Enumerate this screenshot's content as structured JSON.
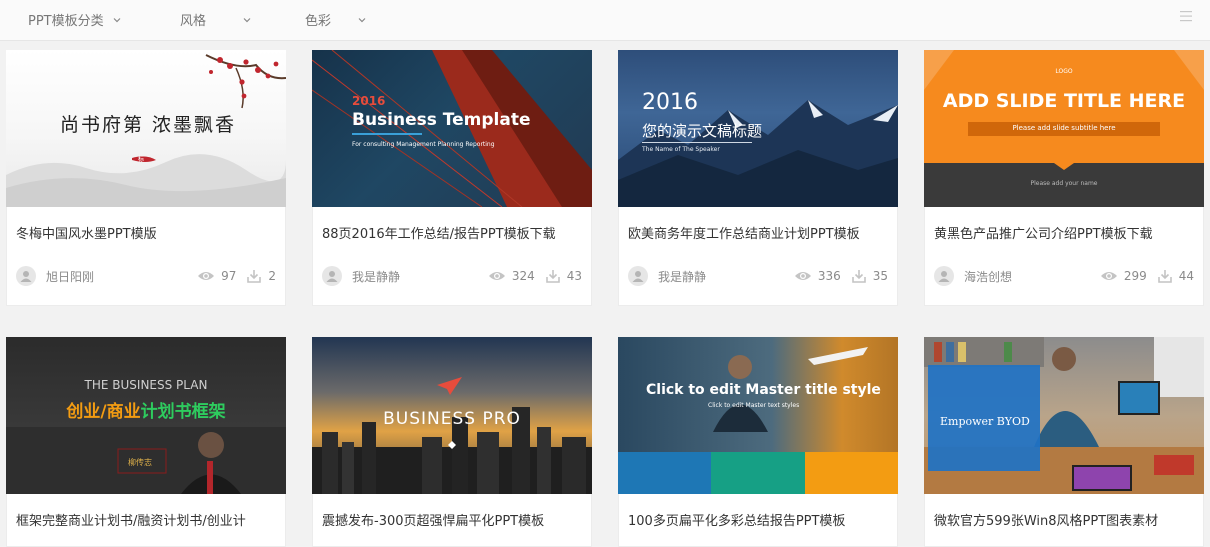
{
  "filters": [
    {
      "label": "PPT模板分类"
    },
    {
      "label": "风格"
    },
    {
      "label": "色彩"
    }
  ],
  "cards": [
    {
      "title": "冬梅中国风水墨PPT模版",
      "author": "旭日阳刚",
      "views": "97",
      "downloads": "2",
      "thumb": {
        "main": "尚书府第  浓墨飘香",
        "stamp": "标"
      }
    },
    {
      "title": "88页2016年工作总结/报告PPT模板下载",
      "author": "我是静静",
      "views": "324",
      "downloads": "43",
      "thumb": {
        "year": "2016",
        "main": "Business Template",
        "sub": "For consulting Management Planning Reporting"
      }
    },
    {
      "title": "欧美商务年度工作总结商业计划PPT模板",
      "author": "我是静静",
      "views": "336",
      "downloads": "35",
      "thumb": {
        "year": "2016",
        "main": "您的演示文稿标题",
        "sub": "The Name of The Speaker"
      }
    },
    {
      "title": "黄黑色产品推广公司介绍PPT模板下载",
      "author": "海浩创想",
      "views": "299",
      "downloads": "44",
      "thumb": {
        "logo": "LOGO",
        "main": "ADD SLIDE TITLE HERE",
        "sub": "Please add slide subtitle here",
        "name": "Please add your name"
      }
    },
    {
      "title": "框架完整商业计划书/融资计划书/创业计",
      "thumb": {
        "top": "THE BUSINESS PLAN",
        "main_a": "创业/商业",
        "main_b": "计划书框架",
        "badge": "柳传志"
      }
    },
    {
      "title": "震撼发布-300页超强悍扁平化PPT模板",
      "thumb": {
        "main": "BUSINESS PRO"
      }
    },
    {
      "title": "100多页扁平化多彩总结报告PPT模板",
      "thumb": {
        "main": "Click to edit Master title style",
        "sub": "Click to edit Master text styles"
      }
    },
    {
      "title": "微软官方599张Win8风格PPT图表素材",
      "thumb": {
        "main": "Empower BYOD"
      }
    }
  ],
  "colors": {
    "text": "#333333",
    "muted": "#8a8a8a",
    "accent_orange": "#f68a1e",
    "accent_green": "#2ecc5e"
  }
}
